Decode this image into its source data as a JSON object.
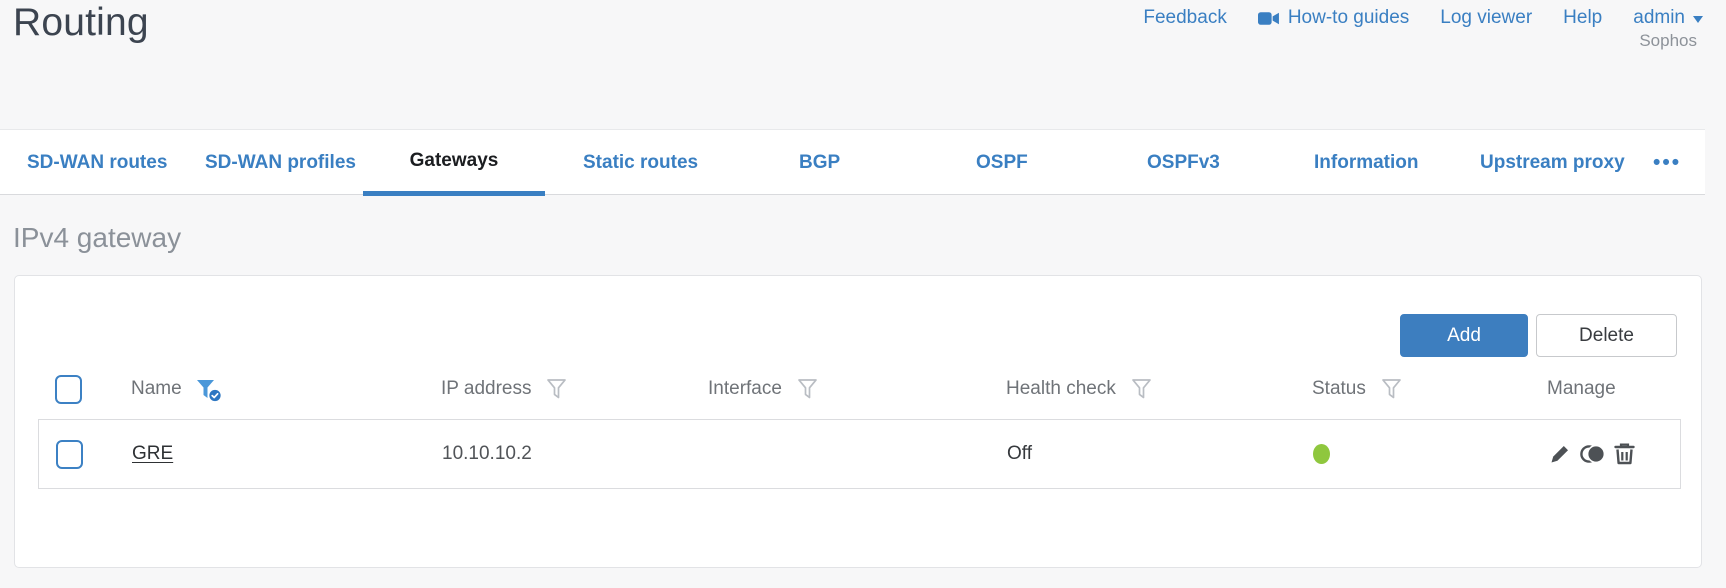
{
  "page_title": "Routing",
  "header": {
    "links": {
      "feedback": "Feedback",
      "howto_guides": "How-to guides",
      "log_viewer": "Log viewer",
      "help": "Help",
      "user": "admin"
    },
    "brand": "Sophos"
  },
  "tabs": [
    {
      "label": "SD-WAN routes",
      "active": false
    },
    {
      "label": "SD-WAN profiles",
      "active": false
    },
    {
      "label": "Gateways",
      "active": true
    },
    {
      "label": "Static routes",
      "active": false
    },
    {
      "label": "BGP",
      "active": false
    },
    {
      "label": "OSPF",
      "active": false
    },
    {
      "label": "OSPFv3",
      "active": false
    },
    {
      "label": "Information",
      "active": false
    },
    {
      "label": "Upstream proxy",
      "active": false
    },
    {
      "label": "•••",
      "active": false
    }
  ],
  "section": {
    "title": "IPv4 gateway"
  },
  "toolbar": {
    "add_label": "Add",
    "delete_label": "Delete"
  },
  "table": {
    "columns": {
      "name": "Name",
      "ip": "IP address",
      "interface": "Interface",
      "health": "Health check",
      "status": "Status",
      "manage": "Manage"
    },
    "filters": {
      "name_filter_active": true
    },
    "rows": [
      {
        "name": "GRE",
        "ip": "10.10.10.2",
        "interface": "",
        "health_check": "Off",
        "status": "up"
      }
    ]
  },
  "colors": {
    "accent_blue": "#3a7fc2",
    "button_blue": "#3d7ebf",
    "status_green": "#8fc73e"
  }
}
